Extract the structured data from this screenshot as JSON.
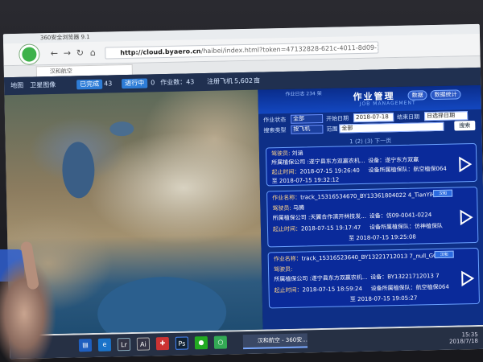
{
  "browser": {
    "window_title": "360安全浏览器 9.1",
    "address_host": "http://cloud.byaero.cn",
    "address_path": "/haibei/index.html?token=47132828-621c-4011-8d09-13fbc1faed4",
    "tab_label": "汉和航空",
    "nav_icons": [
      "back-arrow-icon",
      "forward-arrow-icon",
      "refresh-icon",
      "home-icon"
    ]
  },
  "app_header": {
    "left_items": [
      "地图",
      "卫星图像"
    ],
    "done_label": "已完成",
    "done_count": "43",
    "running_label": "进行中",
    "running_count": "0",
    "jobs_label": "作业数：",
    "jobs_count": "43",
    "field_area_label": "注册飞机",
    "field_area_value": "5,602",
    "area_unit": "亩"
  },
  "panel": {
    "status_text": "作业日志   234 架",
    "title": "作业管理",
    "subtitle": "JOB MANAGEMENT",
    "btn_data": "数据",
    "btn_stats": "数据统计",
    "filters": {
      "status_label": "作业状态",
      "status_value": "全部",
      "start_label": "开始日期",
      "start_value": "2018-07-18",
      "end_label": "结束日期",
      "end_value": "日选择日期",
      "type_label": "搜索类型",
      "type_value": "按飞机",
      "scope_label": "范围",
      "scope_value": "全部",
      "search_btn": "搜索"
    },
    "pager": "1   (2)   (3)   下一页",
    "cards": [
      {
        "pilot_label": "驾驶员:",
        "pilot": "刘涵",
        "company": "所属植保公司 :遂宁县东方双赢农机...",
        "device_label": "设备：",
        "device": "遂宁东方双赢",
        "start_label": "起止时间：",
        "start": "2018-07-15 19:26:40",
        "end_sep": "至",
        "end": "2018-07-15 19:32:12",
        "owner": "设备所属植保队：航空植保064"
      },
      {
        "name_label": "作业名称：",
        "name": "track_15316534670_BY13361804022 4_TianYiHeChu...",
        "pilot_label": "驾驶员:",
        "pilot": "马腾",
        "company": "所属植保公司 :天翼合作演开林技发...",
        "device_label": "设备：",
        "device": "仿09-0041-0224",
        "start_label": "起止时间：",
        "start": "2018-07-15 19:17:47",
        "end_sep": "至",
        "end": "2018-07-15 19:25:08",
        "owner": "设备所属植保队：仿神植保队",
        "badge": "汉和"
      },
      {
        "name_label": "作业名称：",
        "name": "track_15316523640_BY13221712013 7_null_GCS",
        "pilot_label": "驾驶员:",
        "pilot": "",
        "company": "所属植保公司 :遂宁县东方双赢农机...",
        "device_label": "设备：",
        "device": "BY13221712013 7",
        "start_label": "起止时间：",
        "start": "2018-07-15 18:59:24",
        "end_sep": "至",
        "end": "2018-07-15 19:05:27",
        "owner": "设备所属植保队：航空植保064",
        "badge": "汉和"
      }
    ]
  },
  "taskbar": {
    "task_label": "汉和航空 - 360安...",
    "time": "15:35",
    "date": "2018/7/18"
  },
  "colors": {
    "panel_bg": "#0e2f86",
    "accent": "#2e7dd8",
    "label_yellow": "#ffd58a"
  }
}
